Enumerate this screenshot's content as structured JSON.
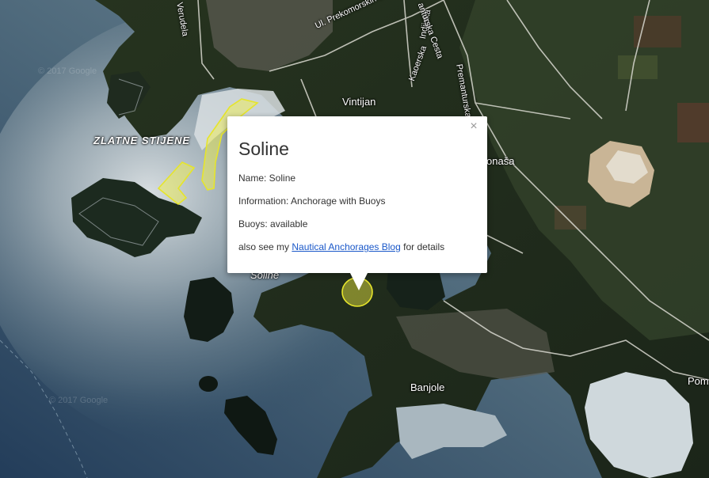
{
  "map": {
    "labels": {
      "zlatne_stijene": "ZLATNE STIJENE",
      "vintijan": "Vintijan",
      "banjole": "Banjole",
      "soline_map": "Soline",
      "nasa": "onaša",
      "pom": "Pom",
      "prekomorskih": "Ul. Prekomorskih brigada",
      "verudela": "Verudela",
      "premanturska": "Premanturska cesta",
      "indijska": "Indijska",
      "karlovac": "Kaoerska",
      "anturska": "anturska Cesta",
      "copyright_top": "© 2017 Google",
      "copyright_bottom": "© 2017 Google"
    },
    "colors": {
      "water_deep": "#2c4a63",
      "water_shallow": "#6f8797",
      "sunglare": "#c9d2d6",
      "land": "#1f2d22",
      "land_light": "#37462d",
      "anchorage_fill": "#f5f243",
      "anchorage_stroke": "#e6e52b"
    }
  },
  "info_window": {
    "title": "Soline",
    "close_glyph": "×",
    "name_label": "Name: Soline",
    "information_label": "Information: Anchorage with Buoys",
    "buoys_label": "Buoys: available",
    "also_see_prefix": "also see my ",
    "blog_link_text": "Nautical Anchorages Blog",
    "also_see_suffix": " for details"
  }
}
